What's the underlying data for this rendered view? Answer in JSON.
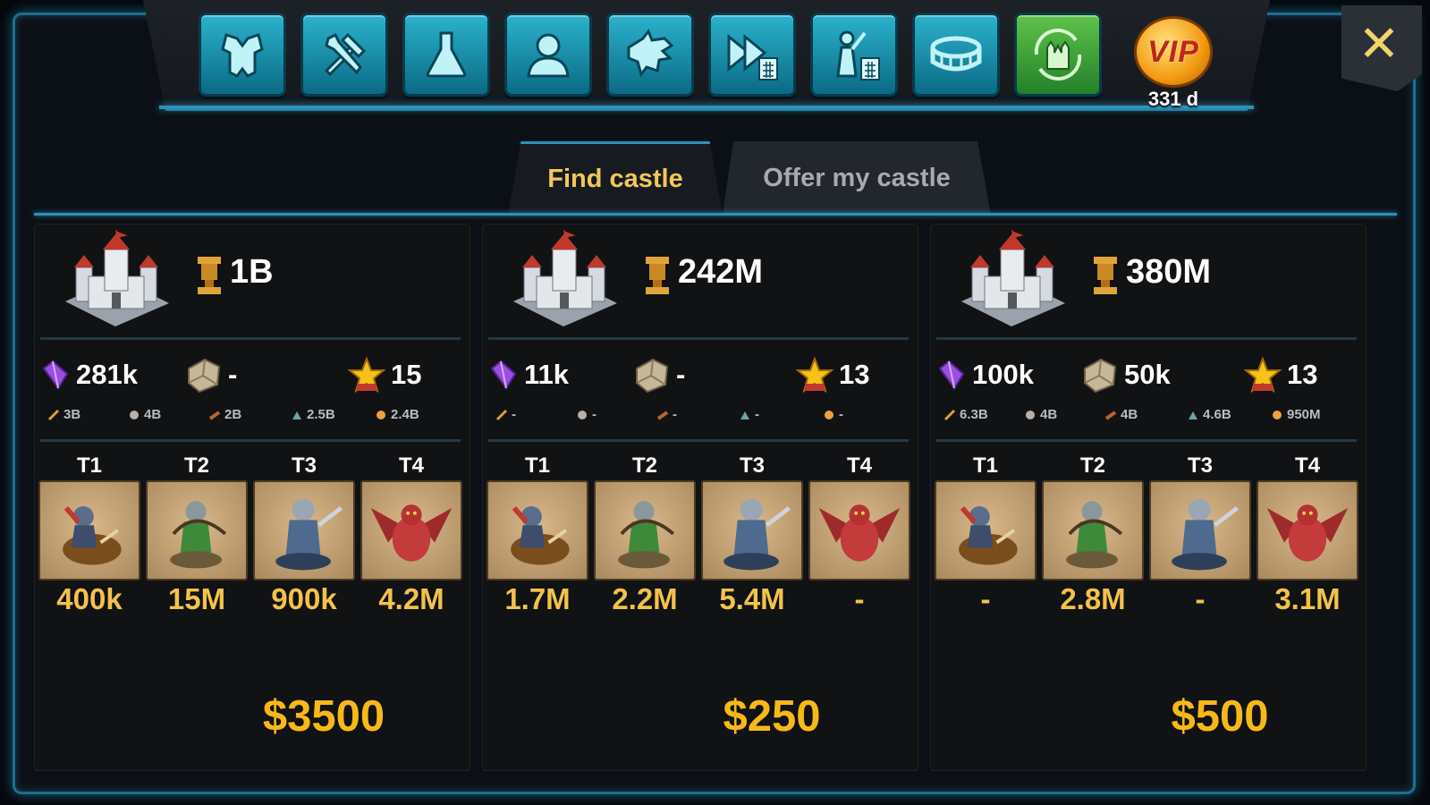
{
  "toolbar": {
    "buttons": [
      {
        "icon": "armor-icon",
        "name": "armor-button"
      },
      {
        "icon": "tools-icon",
        "name": "tools-button"
      },
      {
        "icon": "flask-icon",
        "name": "research-button"
      },
      {
        "icon": "profile-icon",
        "name": "profile-button"
      },
      {
        "icon": "dragon-icon",
        "name": "dragon-button"
      },
      {
        "icon": "speedup-calculator-icon",
        "name": "speedup-calculator-button"
      },
      {
        "icon": "troop-calculator-icon",
        "name": "troop-calculator-button"
      },
      {
        "icon": "arena-icon",
        "name": "arena-button"
      },
      {
        "icon": "castle-trade-icon",
        "name": "castle-trade-button"
      }
    ],
    "vip": {
      "label": "VIP",
      "days": "331 d"
    },
    "close_icon": "close-icon"
  },
  "tabs": {
    "find": "Find castle",
    "offer": "Offer my castle",
    "active": "find"
  },
  "colors": {
    "accent": "#2a93bb",
    "gold": "#f2c24a",
    "price": "#f7b917",
    "tab_active": "#f2c75a"
  },
  "troop_tiers": [
    "T1",
    "T2",
    "T3",
    "T4"
  ],
  "offers": [
    {
      "power": "1B",
      "gems": "281k",
      "stone": "-",
      "stars": "15",
      "mini": [
        "3B",
        "4B",
        "2B",
        "2.5B",
        "2.4B"
      ],
      "troops": [
        "400k",
        "15M",
        "900k",
        "4.2M"
      ],
      "price": "$3500"
    },
    {
      "power": "242M",
      "gems": "11k",
      "stone": "-",
      "stars": "13",
      "mini": [
        "-",
        "-",
        "-",
        "-",
        "-"
      ],
      "troops": [
        "1.7M",
        "2.2M",
        "5.4M",
        "-"
      ],
      "price": "$250"
    },
    {
      "power": "380M",
      "gems": "100k",
      "stone": "50k",
      "stars": "13",
      "mini": [
        "6.3B",
        "4B",
        "4B",
        "4.6B",
        "950M"
      ],
      "troops": [
        "-",
        "2.8M",
        "-",
        "3.1M"
      ],
      "price": "$500"
    }
  ]
}
